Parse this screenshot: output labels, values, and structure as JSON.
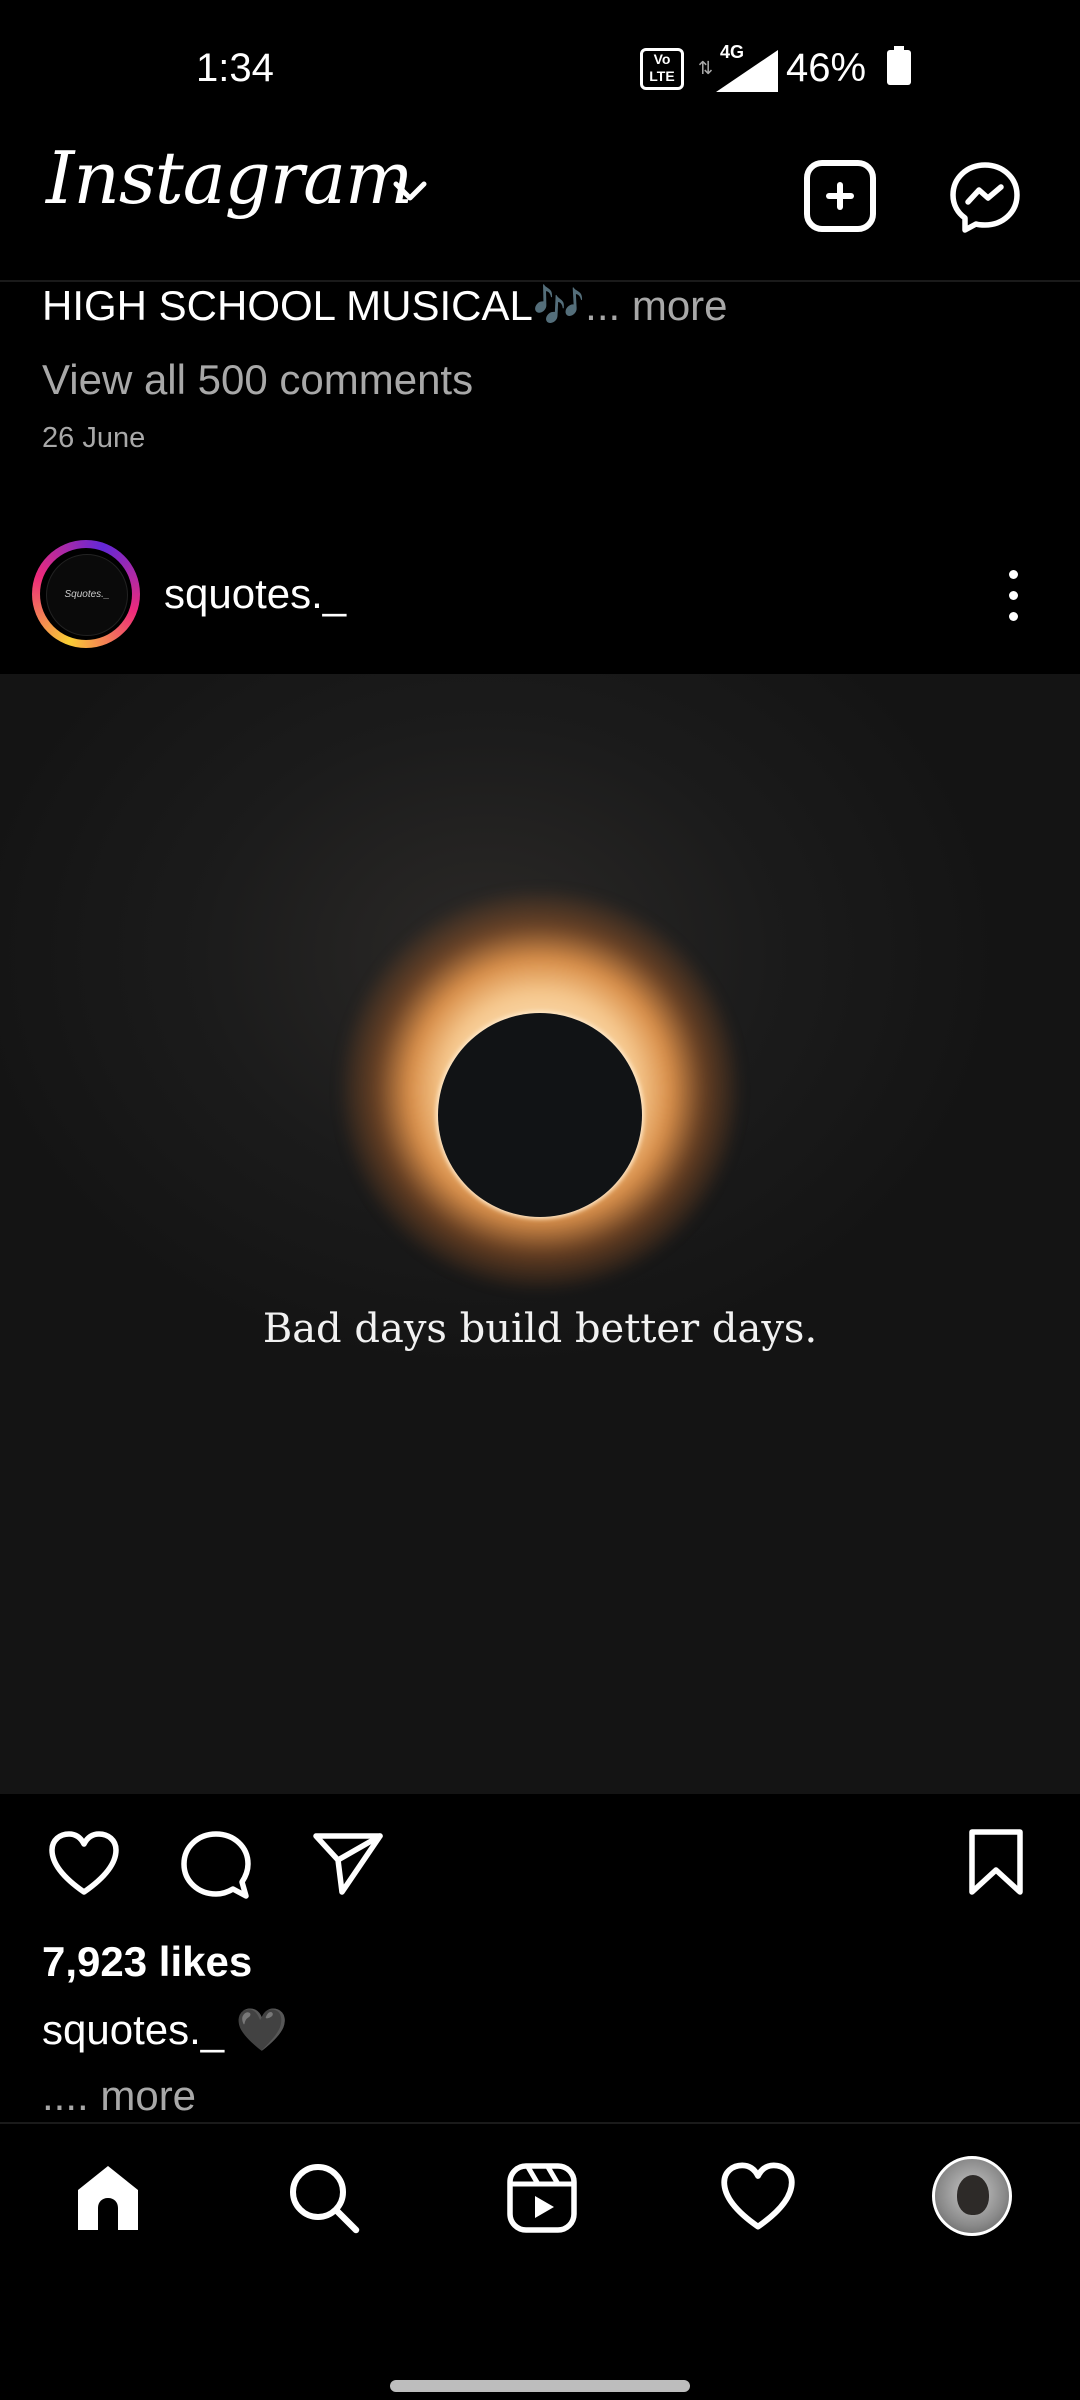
{
  "status_bar": {
    "time": "1:34",
    "volte_label": "Vo LTE",
    "network": "4G",
    "battery_percent": "46%"
  },
  "header": {
    "logo_text": "Instagram"
  },
  "previous_post": {
    "caption_text": "HIGH SCHOOL MUSICAL🎶",
    "caption_more": "... more",
    "view_comments": "View all 500 comments",
    "date": "26 June"
  },
  "post": {
    "username": "squotes._",
    "avatar_text": "Squotes._",
    "image_quote": "Bad days build better days.",
    "likes": "7,923 likes",
    "caption_user": "squotes._",
    "caption_emoji": "🖤",
    "caption_more": ".... more"
  },
  "colors": {
    "background": "#000000",
    "secondary_text": "#a8a8a8"
  },
  "icons": {
    "header": [
      "new-post-icon",
      "messenger-icon"
    ],
    "actions": [
      "heart-icon",
      "comment-icon",
      "share-icon",
      "bookmark-icon"
    ],
    "nav": [
      "home-icon",
      "search-icon",
      "reels-icon",
      "activity-heart-icon",
      "profile-avatar"
    ]
  }
}
